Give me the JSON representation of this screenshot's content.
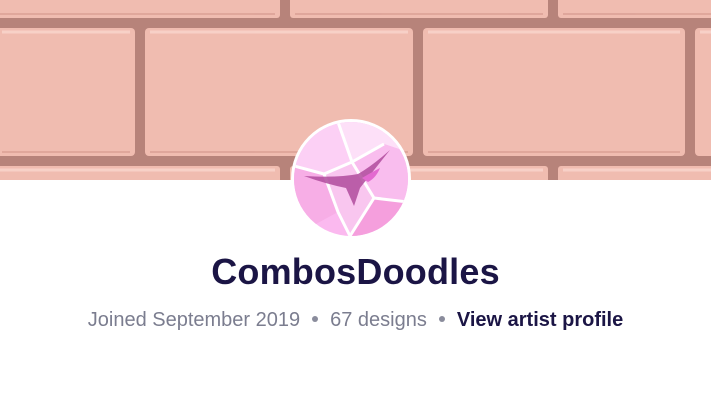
{
  "artist": {
    "name": "CombosDoodles",
    "joined": "Joined September 2019",
    "designs": "67 designs",
    "profile_link": "View artist profile"
  },
  "banner": {
    "description_icon": "pink-brick-wall",
    "brick_color": "#f0bcb0",
    "mortar_color": "#b9837a"
  },
  "avatar": {
    "icon": "pink-crystal-bird-avatar",
    "accent": "#f6a8e6"
  },
  "colors": {
    "name_text": "#1b1545",
    "meta_text": "#7b7d8f"
  }
}
